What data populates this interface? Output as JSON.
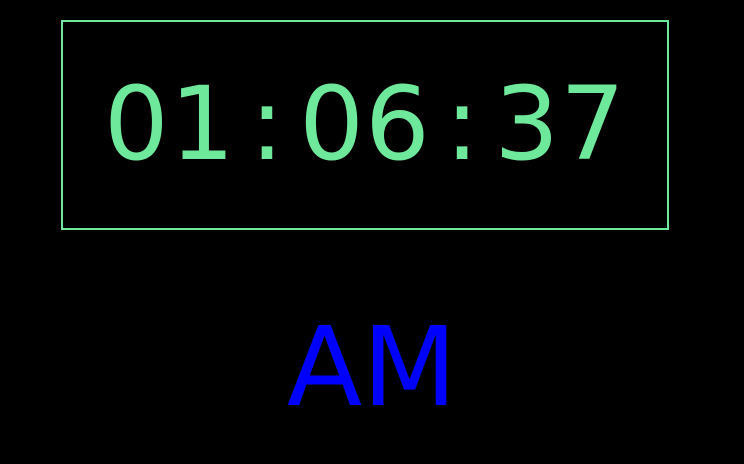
{
  "clock": {
    "hours": "01",
    "minutes": "06",
    "seconds": "37",
    "separator": ":",
    "period": "AM"
  },
  "colors": {
    "background": "#000000",
    "digits": "#6ee89a",
    "frame": "#6ee89a",
    "period": "#0000ff"
  }
}
